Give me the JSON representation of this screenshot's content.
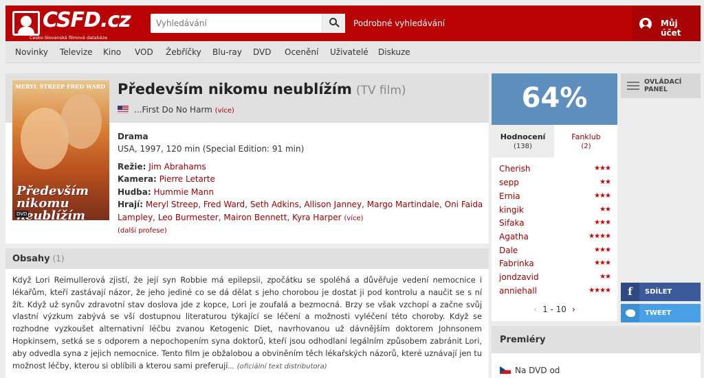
{
  "header": {
    "logo_text": "CSFD.cz",
    "logo_subtitle": "Česko-Slovenská filmová databáze",
    "search_placeholder": "Vyhledávání",
    "advanced_search": "Podrobné vyhledávání",
    "account": "Můj účet",
    "colors": {
      "brand": "#ba0305"
    }
  },
  "nav": {
    "items": [
      "Novinky",
      "Televize",
      "Kino",
      "VOD",
      "Žebříčky",
      "Blu-ray",
      "DVD",
      "Ocenění",
      "Uživatelé",
      "Diskuze"
    ]
  },
  "film": {
    "title": "Především nikomu neublížím",
    "type": "(TV film)",
    "original_title": "...First Do No Harm",
    "original_more": "(více)",
    "genre": "Drama",
    "origin": "USA, 1997, 120 min (Special Edition: 91 min)",
    "poster": {
      "names": "MERYL STREEP   FRED WARD",
      "title": "Především nikomu neublížím",
      "dvd": "DVD"
    },
    "crew": {
      "director_label": "Režie:",
      "director": "Jim Abrahams",
      "camera_label": "Kamera:",
      "camera": "Pierre Letarte",
      "music_label": "Hudba:",
      "music": "Hummie Mann",
      "cast_label": "Hrají:",
      "cast": [
        "Meryl Streep",
        "Fred Ward",
        "Seth Adkins",
        "Allison Janney",
        "Margo Martindale",
        "Oni Faida",
        "Lampley",
        "Leo Burmester",
        "Mairon Bennett",
        "Kyra Harper"
      ],
      "cast_more": "(více)",
      "more_professions": "(další profese)"
    }
  },
  "synopsis": {
    "heading": "Obsahy",
    "count": "(1)",
    "text": "Když Lori Reimullerová zjistí, že její syn Robbie má epilepsii, zpočátku se spoléhá a důvěřuje vedení nemocnice i lékařům, kteří zastávají názor, že jeho jediné co se dá dělat s jeho chorobou je dostat ji pod kontrolu a naučit se s ní žít. Když už synův zdravotní stav doslova jde z kopce, Lori je zoufalá a bezmocná. Brzy se však vzchopí a začne svůj vlastní výzkum zabývá se vší dostupnou literaturou týkající se léčení a možnosti vyléčení této choroby. Když se rozhodne vyzkoušet alternativní léčbu zvanou Ketogenic Diet, navrhovanou už dávnějším doktorem Johnsonem Hopkinsem, setká se s odporem a nepochopením syna doktorů, kteří jsou odhodlaní legálním způsobem zabránit Lori, aby odvedla syna z jejich nemocnice. Tento film je obžalobou a obviněním těch lékařských názorů, které uznávají jen tu možnost léčby, kterou si oblíbili a kterou sami preferují",
    "ellipsis": "...",
    "distributor": "(oficiální text distributora)"
  },
  "rating": {
    "percent": "64%",
    "color": "#5e8fbf",
    "tabs": [
      {
        "label": "Hodnocení",
        "count": "(138)"
      },
      {
        "label": "Fanklub",
        "count": "(2)"
      }
    ],
    "users": [
      {
        "name": "Cherish",
        "stars": "★★★"
      },
      {
        "name": "sepp",
        "stars": "★★"
      },
      {
        "name": "Ernia",
        "stars": "★★★"
      },
      {
        "name": "kingik",
        "stars": "★★"
      },
      {
        "name": "Sifaka",
        "stars": "★★★"
      },
      {
        "name": "Agatha",
        "stars": "★★★★"
      },
      {
        "name": "Dale",
        "stars": "★★★"
      },
      {
        "name": "Fabrinka",
        "stars": "★★★"
      },
      {
        "name": "jondzavid",
        "stars": "★★"
      },
      {
        "name": "anniehall",
        "stars": "★★★★"
      }
    ],
    "pager": "1 - 10"
  },
  "sidebar": {
    "control_panel": "OVLÁDACÍ PANEL",
    "share_fb": "SDÍLET",
    "share_tw": "TWEET"
  },
  "premiery": {
    "heading": "Premiéry",
    "row": "Na DVD od"
  }
}
